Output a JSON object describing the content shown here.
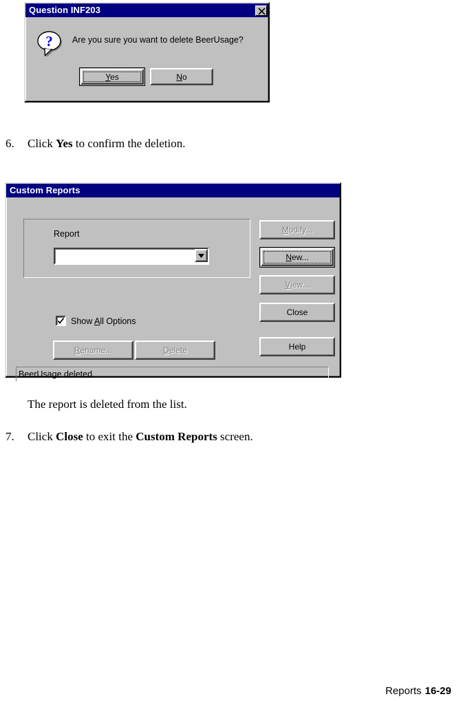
{
  "page": {
    "footer_label": "Reports",
    "footer_page_number": "16-29"
  },
  "question_dialog": {
    "title": "Question INF203",
    "close_icon": "close-x-icon",
    "icon": "question-balloon-icon",
    "message": "Are you sure you want to delete BeerUsage?",
    "buttons": {
      "yes": {
        "label": "Yes",
        "mnemonic": "Y",
        "state": "default-focused"
      },
      "no": {
        "label": "No",
        "mnemonic": "N",
        "state": "normal"
      }
    }
  },
  "steps": {
    "step6": {
      "number": "6.",
      "text_before": "Click ",
      "bold": "Yes",
      "text_after": " to confirm the deletion."
    },
    "note": "The report is deleted from the list.",
    "step7": {
      "number": "7.",
      "text_before": "Click ",
      "bold1": "Close",
      "text_middle": " to exit the ",
      "bold2": "Custom Reports",
      "text_after": " screen."
    }
  },
  "custom_reports": {
    "title": "Custom Reports",
    "group_label": "Report",
    "combo": {
      "value": "",
      "placeholder": "",
      "dropdown_icon": "chevron-down-icon"
    },
    "checkbox": {
      "label_before": "Show ",
      "mnemonic": "A",
      "label_after": "ll Options",
      "checked": true,
      "check_icon": "checkmark-icon"
    },
    "buttons": {
      "rename": {
        "label": "Rename...",
        "mnemonic": "R",
        "enabled": false
      },
      "delete": {
        "label": "Delete",
        "mnemonic": "D",
        "enabled": false
      },
      "modify": {
        "label": "Modify...",
        "mnemonic": "M",
        "enabled": false
      },
      "new": {
        "label": "New...",
        "mnemonic": "N",
        "enabled": true,
        "state": "default-focused"
      },
      "view": {
        "label": "View...",
        "mnemonic": "V",
        "enabled": false
      },
      "close": {
        "label": "Close",
        "enabled": true
      },
      "help": {
        "label": "Help",
        "enabled": true
      }
    },
    "status_text": "BeerUsage deleted."
  },
  "colors": {
    "titlebar": "#000080",
    "face": "#c0c0c0",
    "shadow": "#808080",
    "dark_shadow": "#404040",
    "highlight": "#ffffff",
    "icon_blue": "#0000cc"
  }
}
